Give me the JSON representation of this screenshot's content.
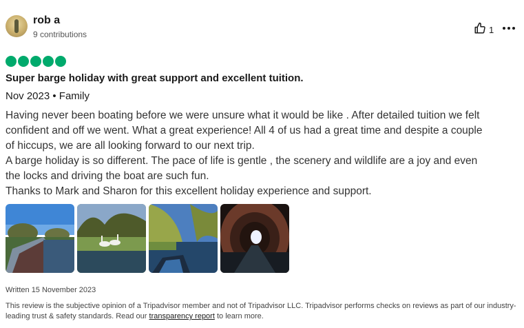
{
  "reviewer": {
    "name": "rob a",
    "contributions": "9 contributions"
  },
  "actions": {
    "helpful_count": "1",
    "helpful_icon": "thumbs-up-icon",
    "more_icon": "more-options-icon"
  },
  "rating": {
    "value": 5,
    "max": 5,
    "color": "#00aa6c"
  },
  "review": {
    "title": "Super barge holiday with great support and excellent tuition.",
    "meta": "Nov 2023 • Family",
    "lines": [
      "Having never been boating before we were unsure what it would be like . After detailed tuition we felt",
      "confident and off we went. What a great experience! All 4 of us had a great time and despite a couple",
      "of hiccups, we are all looking forward to our next trip.",
      "A barge holiday is so different. The pace of life is gentle , the scenery and wildlife are a joy and even",
      "the locks and driving the boat are such fun.",
      "Thanks to Mark and Sharon for this excellent holiday experience and support."
    ]
  },
  "photos": [
    {
      "subject": "canal-boat-roof-photo"
    },
    {
      "subject": "swans-on-canal-photo"
    },
    {
      "subject": "boat-bow-under-willow-photo"
    },
    {
      "subject": "canal-tunnel-photo"
    }
  ],
  "footer": {
    "written": "Written 15 November 2023",
    "disclaimer_before": "This review is the subjective opinion of a Tripadvisor member and not of Tripadvisor LLC. Tripadvisor performs checks on reviews as part of our industry-leading trust & safety standards. Read our ",
    "link": "transparency report",
    "disclaimer_after": " to learn more."
  }
}
